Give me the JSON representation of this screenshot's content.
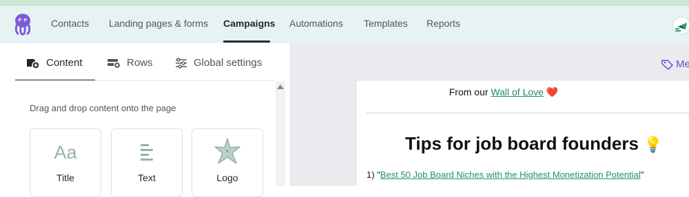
{
  "nav": {
    "items": [
      {
        "label": "Contacts",
        "active": false
      },
      {
        "label": "Landing pages & forms",
        "active": false
      },
      {
        "label": "Campaigns",
        "active": true
      },
      {
        "label": "Automations",
        "active": false
      },
      {
        "label": "Templates",
        "active": false
      },
      {
        "label": "Reports",
        "active": false
      }
    ],
    "logo_icon": "octopus-logo-icon",
    "avatar_icon": "user-avatar-icon"
  },
  "editor": {
    "tabs": [
      {
        "label": "Content",
        "icon": "content-add-icon",
        "active": true
      },
      {
        "label": "Rows",
        "icon": "rows-add-icon",
        "active": false
      },
      {
        "label": "Global settings",
        "icon": "sliders-icon",
        "active": false
      }
    ],
    "hint": "Drag and drop content onto the page",
    "tiles": [
      {
        "label": "Title",
        "icon": "title-aa-icon"
      },
      {
        "label": "Text",
        "icon": "text-lines-icon"
      },
      {
        "label": "Logo",
        "icon": "starfish-logo-icon"
      }
    ]
  },
  "email": {
    "from_prefix": "From our ",
    "from_link": "Wall of Love",
    "heart": "❤️",
    "title": "Tips for job board founders",
    "bulb": "💡",
    "tip1_prefix": "1) \"",
    "tip1_link": "Best 50 Job Board Niches with the Highest Monetization Potential",
    "tip1_suffix": "\""
  },
  "right_action": {
    "label": "Me",
    "icon": "tag-icon"
  },
  "colors": {
    "nav_bg": "#e6f3f2",
    "accent": "#1f2c3d",
    "link": "#1f8f5f",
    "mentions": "#5b4fc9",
    "logo": "#7c5cd6",
    "tile_icon": "#8fb3ad"
  }
}
